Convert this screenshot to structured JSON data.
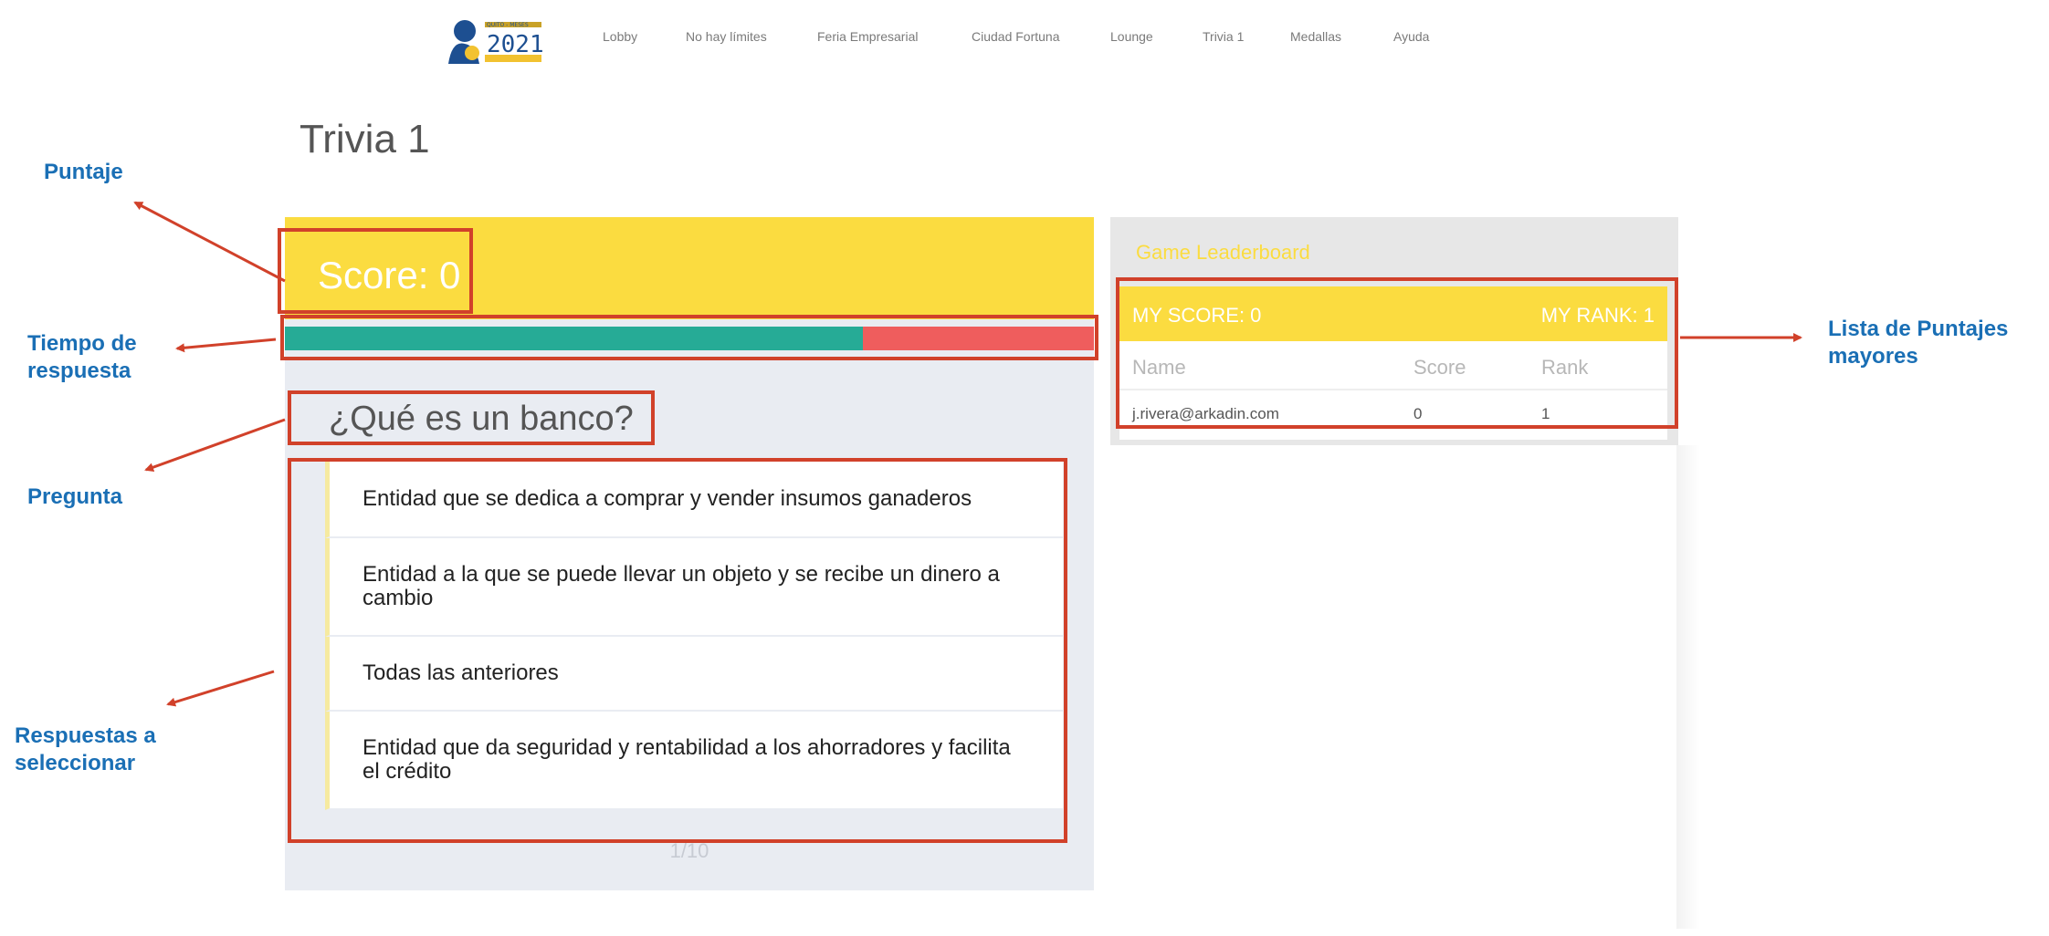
{
  "nav": {
    "logo": {
      "year": "2021",
      "caption": "QUITO - MESES"
    },
    "items": [
      "Lobby",
      "No hay límites",
      "Feria Empresarial",
      "Ciudad Fortuna",
      "Lounge",
      "Trivia 1",
      "Medallas",
      "Ayuda"
    ]
  },
  "page": {
    "title": "Trivia 1"
  },
  "trivia": {
    "score_text": "Score: 0",
    "timer_remaining_fraction": 0.715,
    "question": "¿Qué es un banco?",
    "answers": [
      "Entidad que se dedica a comprar y vender insumos ganaderos",
      "Entidad a la que se puede llevar un objeto y se recibe un dinero a cambio",
      "Todas las anteriores",
      "Entidad que da seguridad y rentabilidad a los ahorradores y facilita el crédito"
    ],
    "counter": "1/10"
  },
  "leaderboard": {
    "title": "Game Leaderboard",
    "my_score": "MY SCORE: 0",
    "my_rank": "MY RANK: 1",
    "headers": {
      "name": "Name",
      "score": "Score",
      "rank": "Rank"
    },
    "rows": [
      {
        "name": "j.rivera@arkadin.com",
        "score": "0",
        "rank": "1"
      }
    ]
  },
  "callouts": {
    "puntaje": "Puntaje",
    "tiempo_line1": "Tiempo de",
    "tiempo_line2": "respuesta",
    "pregunta": "Pregunta",
    "respuestas_line1": "Respuestas a",
    "respuestas_line2": "seleccionar",
    "lista_line1": "Lista de Puntajes",
    "lista_line2": "mayores"
  },
  "colors": {
    "accent_yellow": "#fbdc40",
    "timer_green": "#26ab96",
    "timer_red": "#ef5d5d",
    "annotation_red": "#d1412a",
    "annotation_blue": "#1a6fb5"
  }
}
